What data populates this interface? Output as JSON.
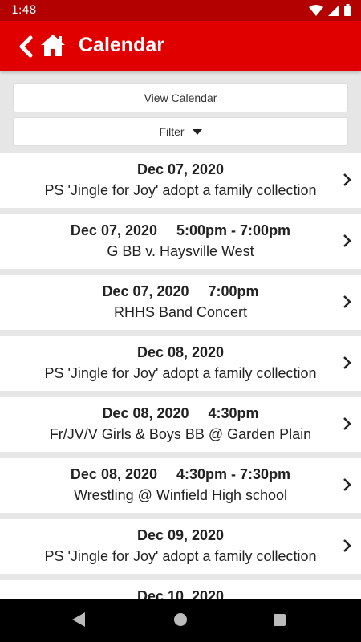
{
  "statusbar": {
    "time": "1:48"
  },
  "appbar": {
    "title": "Calendar"
  },
  "controls": {
    "view_calendar": "View Calendar",
    "filter": "Filter"
  },
  "events": [
    {
      "date": "Dec 07, 2020",
      "time": "",
      "title": "PS 'Jingle for Joy' adopt a family collection"
    },
    {
      "date": "Dec 07, 2020",
      "time": "5:00pm - 7:00pm",
      "title": "G BB v. Haysville West"
    },
    {
      "date": "Dec 07, 2020",
      "time": "7:00pm",
      "title": "RHHS Band Concert"
    },
    {
      "date": "Dec 08, 2020",
      "time": "",
      "title": "PS 'Jingle for Joy' adopt a family collection"
    },
    {
      "date": "Dec 08, 2020",
      "time": "4:30pm",
      "title": "Fr/JV/V Girls & Boys BB @ Garden Plain"
    },
    {
      "date": "Dec 08, 2020",
      "time": "4:30pm - 7:30pm",
      "title": "Wrestling @ Winfield High school"
    },
    {
      "date": "Dec 09, 2020",
      "time": "",
      "title": "PS 'Jingle for Joy' adopt a family collection"
    },
    {
      "date": "Dec 10, 2020",
      "time": "",
      "title": ""
    }
  ]
}
